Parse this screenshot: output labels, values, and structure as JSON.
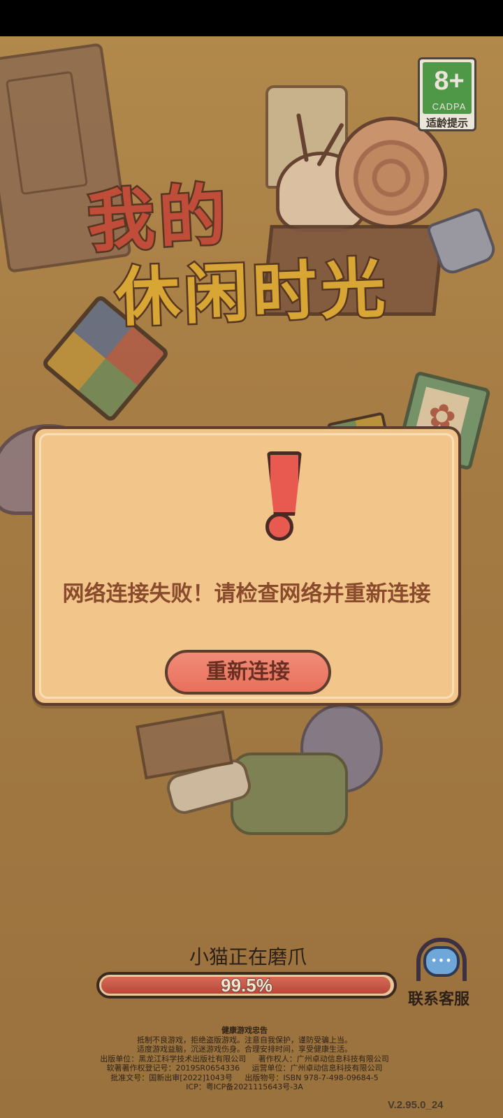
{
  "game": {
    "title_line1": "我的",
    "title_line2": "休闲时光"
  },
  "age_rating": {
    "age": "8+",
    "org": "CADPA",
    "tip": "适龄提示"
  },
  "dialog": {
    "message": "网络连接失败！请检查网络并重新连接",
    "retry_label": "重新连接",
    "icon": "exclamation-icon"
  },
  "loading": {
    "status_text": "小猫正在磨爪",
    "progress_text": "99.5%",
    "progress_fraction": 0.995
  },
  "support": {
    "label": "联系客服",
    "icon": "headset-chat-icon"
  },
  "footer": {
    "health_title": "健康游戏忠告",
    "health_line1": "抵制不良游戏，拒绝盗版游戏。注意自我保护，谨防受骗上当。",
    "health_line2": "适度游戏益脑，沉迷游戏伤身。合理安排时间，享受健康生活。",
    "publisher": "出版单位：黑龙江科学技术出版社有限公司",
    "copyright_owner": "著作权人：广州卓动信息科技有限公司",
    "software_reg": "软著著作权登记号：2019SR0654336",
    "operator": "运营单位：广州卓动信息科技有限公司",
    "approval": "批准文号：国新出审[2022]1043号",
    "publication": "出版物号：ISBN 978-7-498-09684-5",
    "icp": "ICP：粤ICP备2021115643号-3A"
  },
  "version": "V.2.95.0_24",
  "colors": {
    "dialog_bg": "#f2c58a",
    "button": "#e8705c",
    "progress_fill": "#c0503f",
    "rating_green": "#3fa24a"
  }
}
